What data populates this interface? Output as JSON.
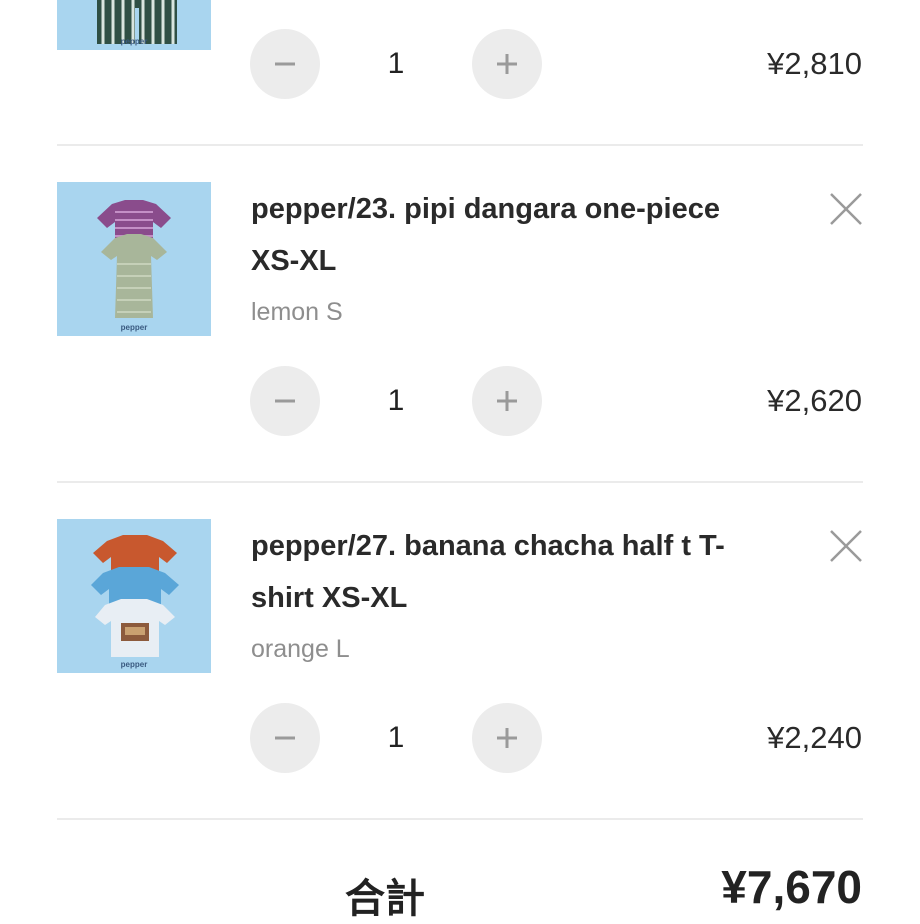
{
  "items": [
    {
      "title": "",
      "variant": "",
      "quantity": "1",
      "price": "¥2,810",
      "brand": "pepper"
    },
    {
      "title": "pepper/23. pipi dangara one-piece XS-XL",
      "variant": "lemon S",
      "quantity": "1",
      "price": "¥2,620",
      "brand": "pepper"
    },
    {
      "title": "pepper/27. banana chacha half t T-shirt XS-XL",
      "variant": "orange L",
      "quantity": "1",
      "price": "¥2,240",
      "brand": "pepper"
    }
  ],
  "total": {
    "label": "合計",
    "value": "¥7,670"
  },
  "colors": {
    "thumb_bg": "#a9d5ef",
    "button_bg": "#ececec",
    "divider": "#ebebeb"
  },
  "icons": {
    "decrease": "minus-icon",
    "increase": "plus-icon",
    "remove": "close-icon"
  }
}
